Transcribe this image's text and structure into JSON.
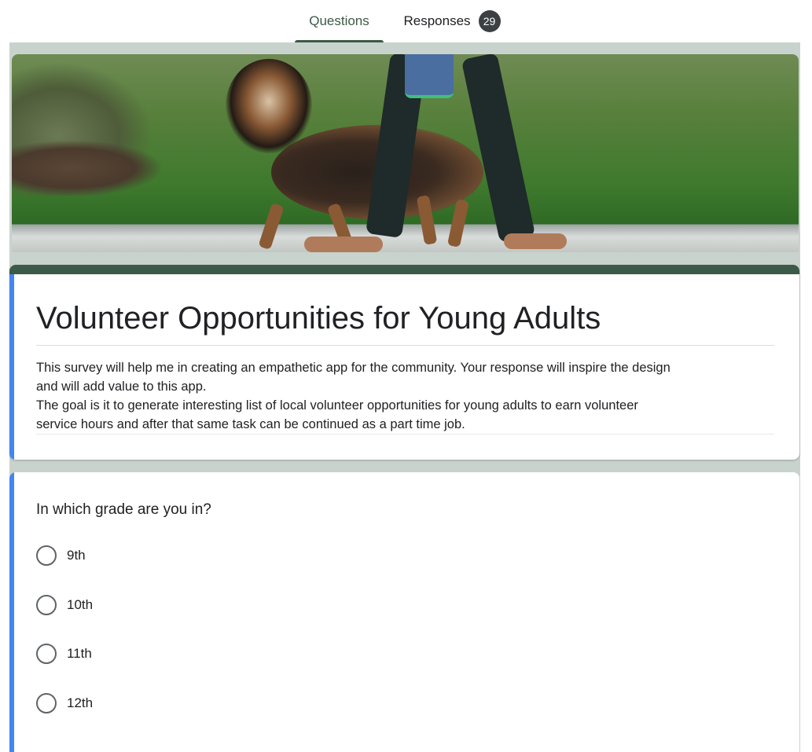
{
  "tabs": {
    "questions_label": "Questions",
    "responses_label": "Responses",
    "responses_count": "29"
  },
  "form": {
    "title": "Volunteer Opportunities for Young Adults",
    "description_lines": [
      "This survey will help me in creating an empathetic app for the community. Your response will inspire the design",
      "and will add value to this app.",
      "The goal is it to generate interesting list of local volunteer opportunities for young adults to earn volunteer",
      "service hours and after that same task can be continued as a part time job."
    ]
  },
  "question": {
    "title": "In which grade are you in?",
    "options": [
      {
        "label": "9th"
      },
      {
        "label": "10th"
      },
      {
        "label": "11th"
      },
      {
        "label": "12th"
      }
    ]
  },
  "colors": {
    "theme": "#3b5a47",
    "accent": "#4285f4",
    "background": "#c9d3cd"
  }
}
